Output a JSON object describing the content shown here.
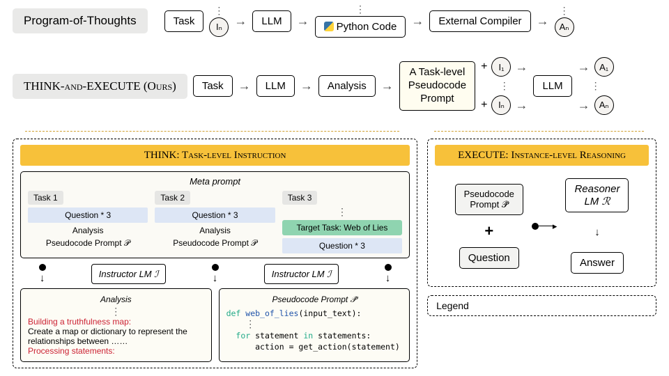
{
  "top": {
    "pot_label": "Program-of-Thoughts",
    "ours_label": "THINK-and-EXECUTE (Ours)",
    "task": "Task",
    "llm": "LLM",
    "analysis": "Analysis",
    "pseudocode_prompt_box": "A Task-level\nPseudocode\nPrompt",
    "python_code": "Python Code",
    "external_compiler": "External Compiler",
    "I1": "I₁",
    "In": "Iₙ",
    "A1": "A₁",
    "An": "Aₙ",
    "plus": "+",
    "arrow": "→"
  },
  "think": {
    "header": "THINK: Task-level Instruction",
    "meta_title": "Meta prompt",
    "tasks": [
      {
        "label": "Task 1",
        "q": "Question * 3",
        "a": "Analysis",
        "p": "Pseudocode Prompt 𝒫"
      },
      {
        "label": "Task 2",
        "q": "Question * 3",
        "a": "Analysis",
        "p": "Pseudocode Prompt 𝒫"
      },
      {
        "label": "Task 3",
        "target": "Target Task: Web of Lies",
        "q": "Question * 3"
      }
    ],
    "instructor": "Instructor LM ℐ",
    "analysis_title": "Analysis",
    "a_line1": "Building a truthfulness map:",
    "a_line2": "Create a map or dictionary to represent the relationships between ……",
    "a_line3": "Processing statements:",
    "pseudo_title": "Pseudocode Prompt 𝒫̂",
    "code_def": "def ",
    "code_fn": "web_of_lies",
    "code_arg": "(input_text):",
    "code_for": "for ",
    "code_stmt": "statement ",
    "code_in": "in ",
    "code_stmts": "statements:",
    "code_body": "action = get_action(statement)"
  },
  "exec": {
    "header": "EXECUTE: Instance-level Reasoning",
    "pp": "Pseudocode\nPrompt 𝒫̂",
    "plus": "+",
    "question": "Question",
    "reasoner": "Reasoner\nLM ℛ",
    "answer": "Answer"
  },
  "legend": "Legend"
}
